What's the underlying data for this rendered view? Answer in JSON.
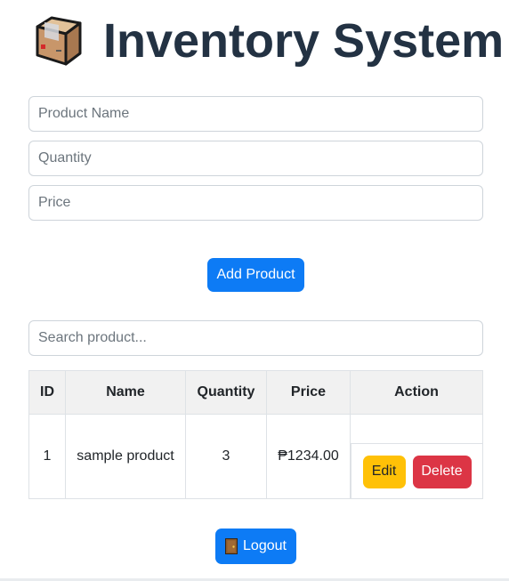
{
  "header": {
    "title": "Inventory System",
    "icon": "package-box-icon"
  },
  "form": {
    "product_name_placeholder": "Product Name",
    "quantity_placeholder": "Quantity",
    "price_placeholder": "Price",
    "add_button_label": "Add Product"
  },
  "search": {
    "placeholder": "Search product..."
  },
  "table": {
    "headers": {
      "id": "ID",
      "name": "Name",
      "quantity": "Quantity",
      "price": "Price",
      "action": "Action"
    },
    "rows": [
      {
        "id": "1",
        "name": "sample product",
        "quantity": "3",
        "price": "₱1234.00",
        "edit_label": "Edit",
        "delete_label": "Delete"
      }
    ]
  },
  "logout": {
    "label": "Logout",
    "icon": "door-icon"
  },
  "colors": {
    "title": "#233243",
    "primary": "#0d7bf5",
    "warning": "#ffc107",
    "danger": "#dc3545",
    "header_bg": "#f1f1f1"
  }
}
